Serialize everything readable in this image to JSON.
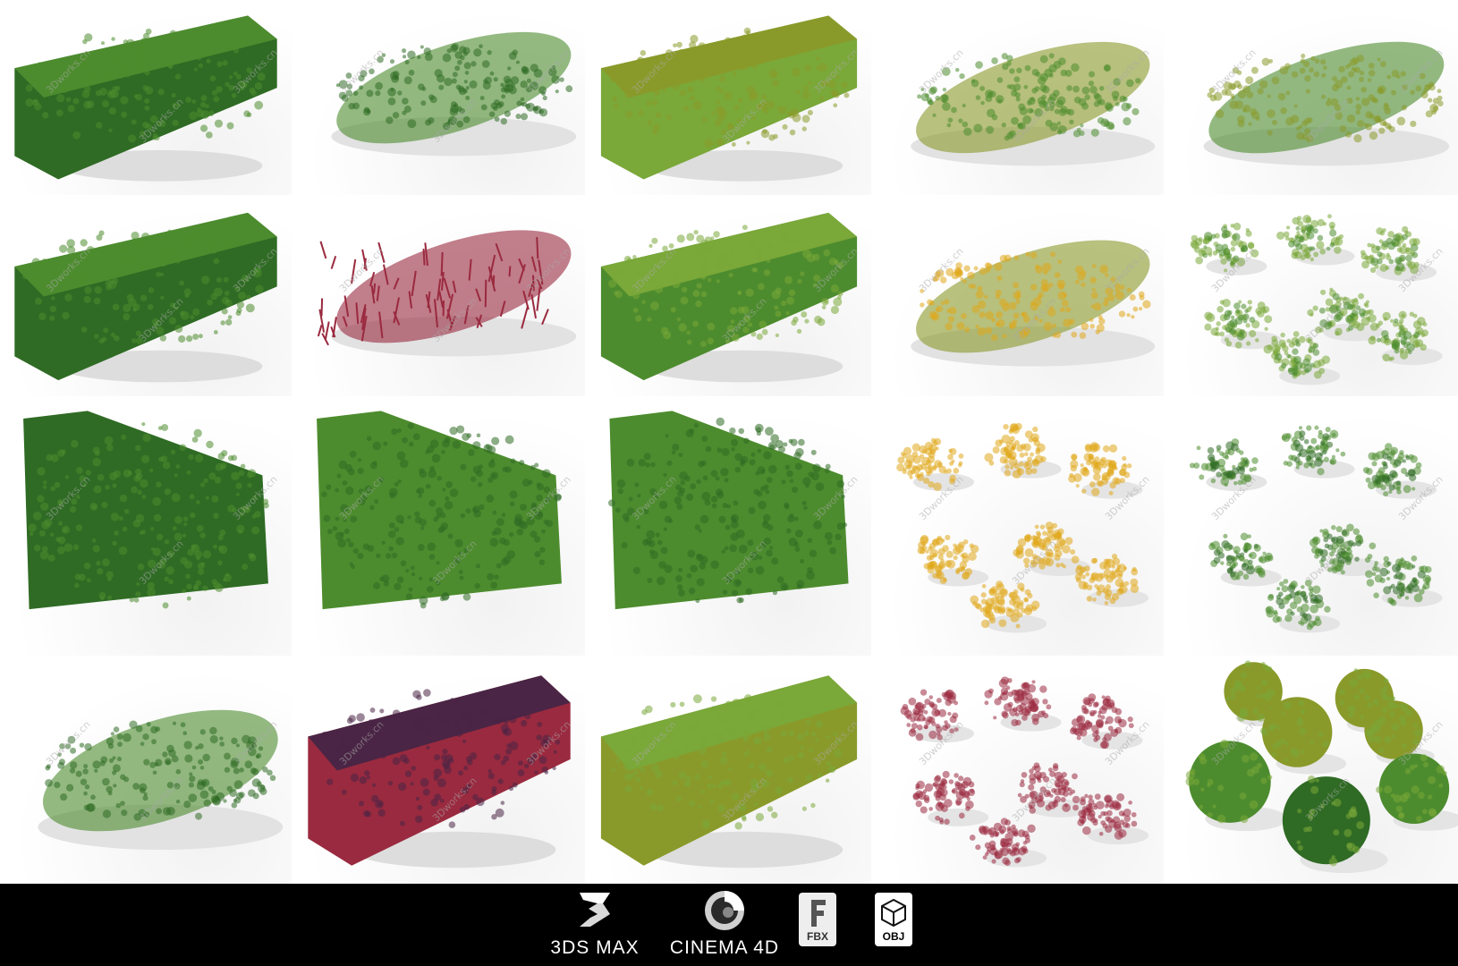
{
  "watermark_text": "3Dworks.cn",
  "colors": {
    "hedge_dark": "#2f6b24",
    "hedge_mid": "#4d8c2e",
    "hedge_light": "#7aa839",
    "olive": "#8a9a2a",
    "crimson": "#9a2a3f",
    "purple": "#4a2545",
    "yellow": "#e0a81a",
    "footer_bg": "#000000"
  },
  "footer": {
    "logos": [
      {
        "label": "3DS MAX",
        "icon": "3dsmax-logo-icon"
      },
      {
        "label": "CINEMA 4D",
        "icon": "cinema4d-logo-icon"
      }
    ],
    "badges": [
      {
        "label": "FBX",
        "icon": "fbx-file-icon"
      },
      {
        "label": "OBJ",
        "icon": "obj-file-icon"
      }
    ]
  }
}
